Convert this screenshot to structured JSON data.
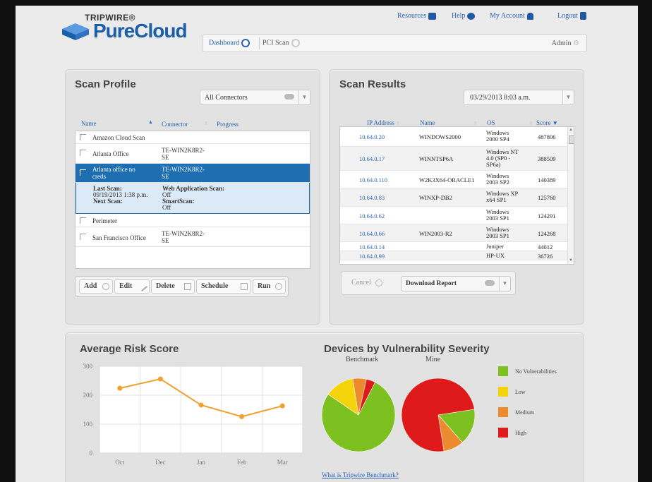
{
  "header": {
    "brand_top": "TRIPWIRE®",
    "brand_name": "PureCloud",
    "nav": {
      "resources": "Resources",
      "help": "Help",
      "account": "My Account",
      "logout": "Logout"
    },
    "tabs": {
      "dashboard": "Dashboard",
      "pci": "PCI Scan"
    },
    "admin": "Admin"
  },
  "scan_profile": {
    "title": "Scan Profile",
    "filter": "All Connectors",
    "columns": {
      "name": "Name",
      "connector": "Connector",
      "progress": "Progress"
    },
    "rows": [
      {
        "name": "Amazon Cloud Scan",
        "connector": ""
      },
      {
        "name": "Atlanta Office",
        "connector": "TE-WIN2K8R2-\nSE"
      },
      {
        "name": "Atlanta office no\ncreds",
        "connector": "TE-WIN2K8R2-\nSE"
      },
      {
        "name": "Perimeter",
        "connector": ""
      },
      {
        "name": "San Francisco Office",
        "connector": "TE-WIN2K8R2-\nSE"
      }
    ],
    "detail": {
      "last_scan_label": "Last Scan:",
      "last_scan_value": "09/19/2013 1:38 p.m.",
      "next_scan_label": "Next Scan:",
      "web_label": "Web Application Scan:",
      "web_value": "Off",
      "smart_label": "SmartScan:",
      "smart_value": "Off"
    },
    "buttons": {
      "add": "Add",
      "edit": "Edit",
      "delete": "Delete",
      "schedule": "Schedule",
      "run": "Run"
    }
  },
  "scan_results": {
    "title": "Scan Results",
    "date": "03/29/2013 8:03 a.m.",
    "columns": {
      "ip": "IP Address",
      "name": "Name",
      "os": "OS",
      "score": "Score"
    },
    "rows": [
      {
        "ip": "10.64.0.20",
        "name": "WINDOWS2000",
        "os": "Windows\n2000 SP4",
        "score": "487806"
      },
      {
        "ip": "10.64.0.17",
        "name": "WINNTSP6A",
        "os": "Windows NT\n4.0 (SP0 -\nSP6a)",
        "score": "388509"
      },
      {
        "ip": "10.64.0.110",
        "name": "W2K3X64-ORACLE1",
        "os": "Windows\n2003 SP2",
        "score": "140389"
      },
      {
        "ip": "10.64.0.83",
        "name": "WINXP-DB2",
        "os": "Windows XP\nx64 SP1",
        "score": "125760"
      },
      {
        "ip": "10.64.0.62",
        "name": "",
        "os": "Windows\n2003 SP1",
        "score": "124291"
      },
      {
        "ip": "10.64.0.66",
        "name": "WIN2003-R2",
        "os": "Windows\n2003 SP1",
        "score": "124268"
      },
      {
        "ip": "10.64.0.14",
        "name": "",
        "os": "Juniper",
        "score": "44012"
      },
      {
        "ip": "10.64.0.99",
        "name": "",
        "os": "HP-UX",
        "score": "36726"
      }
    ],
    "cancel": "Cancel",
    "download": "Download Report"
  },
  "risk_chart": {
    "title": "Average Risk Score"
  },
  "chart_data": [
    {
      "type": "line",
      "title": "Average Risk Score",
      "categories": [
        "Oct",
        "Dec",
        "Jan",
        "Feb",
        "Mar"
      ],
      "values": [
        224,
        256,
        166,
        126,
        163
      ],
      "ylim": [
        0,
        300
      ],
      "yticks": [
        0,
        100,
        200,
        300
      ],
      "grid": true,
      "color": "#f0a030"
    },
    {
      "type": "pie",
      "title": "Devices by Vulnerability Severity",
      "pies": [
        {
          "label": "Benchmark",
          "values": [
            {
              "category": "No Vulnerabilities",
              "value": 77
            },
            {
              "category": "Low",
              "value": 13
            },
            {
              "category": "Medium",
              "value": 6
            },
            {
              "category": "High",
              "value": 4
            }
          ]
        },
        {
          "label": "Mine",
          "values": [
            {
              "category": "No Vulnerabilities",
              "value": 16
            },
            {
              "category": "Low",
              "value": 0
            },
            {
              "category": "Medium",
              "value": 9
            },
            {
              "category": "High",
              "value": 75
            }
          ]
        }
      ],
      "legend": [
        "No Vulnerabilities",
        "Low",
        "Medium",
        "High"
      ],
      "colors": {
        "No Vulnerabilities": "#7cc11f",
        "Low": "#f5d30a",
        "Medium": "#ec8a2e",
        "High": "#de1a1a"
      }
    }
  ],
  "devices": {
    "title": "Devices by Vulnerability Severity",
    "benchmark": "Benchmark",
    "mine": "Mine",
    "legend": [
      "No Vulnerabilities",
      "Low",
      "Medium",
      "High"
    ],
    "link": "What is Tripwire Benchmark?"
  }
}
